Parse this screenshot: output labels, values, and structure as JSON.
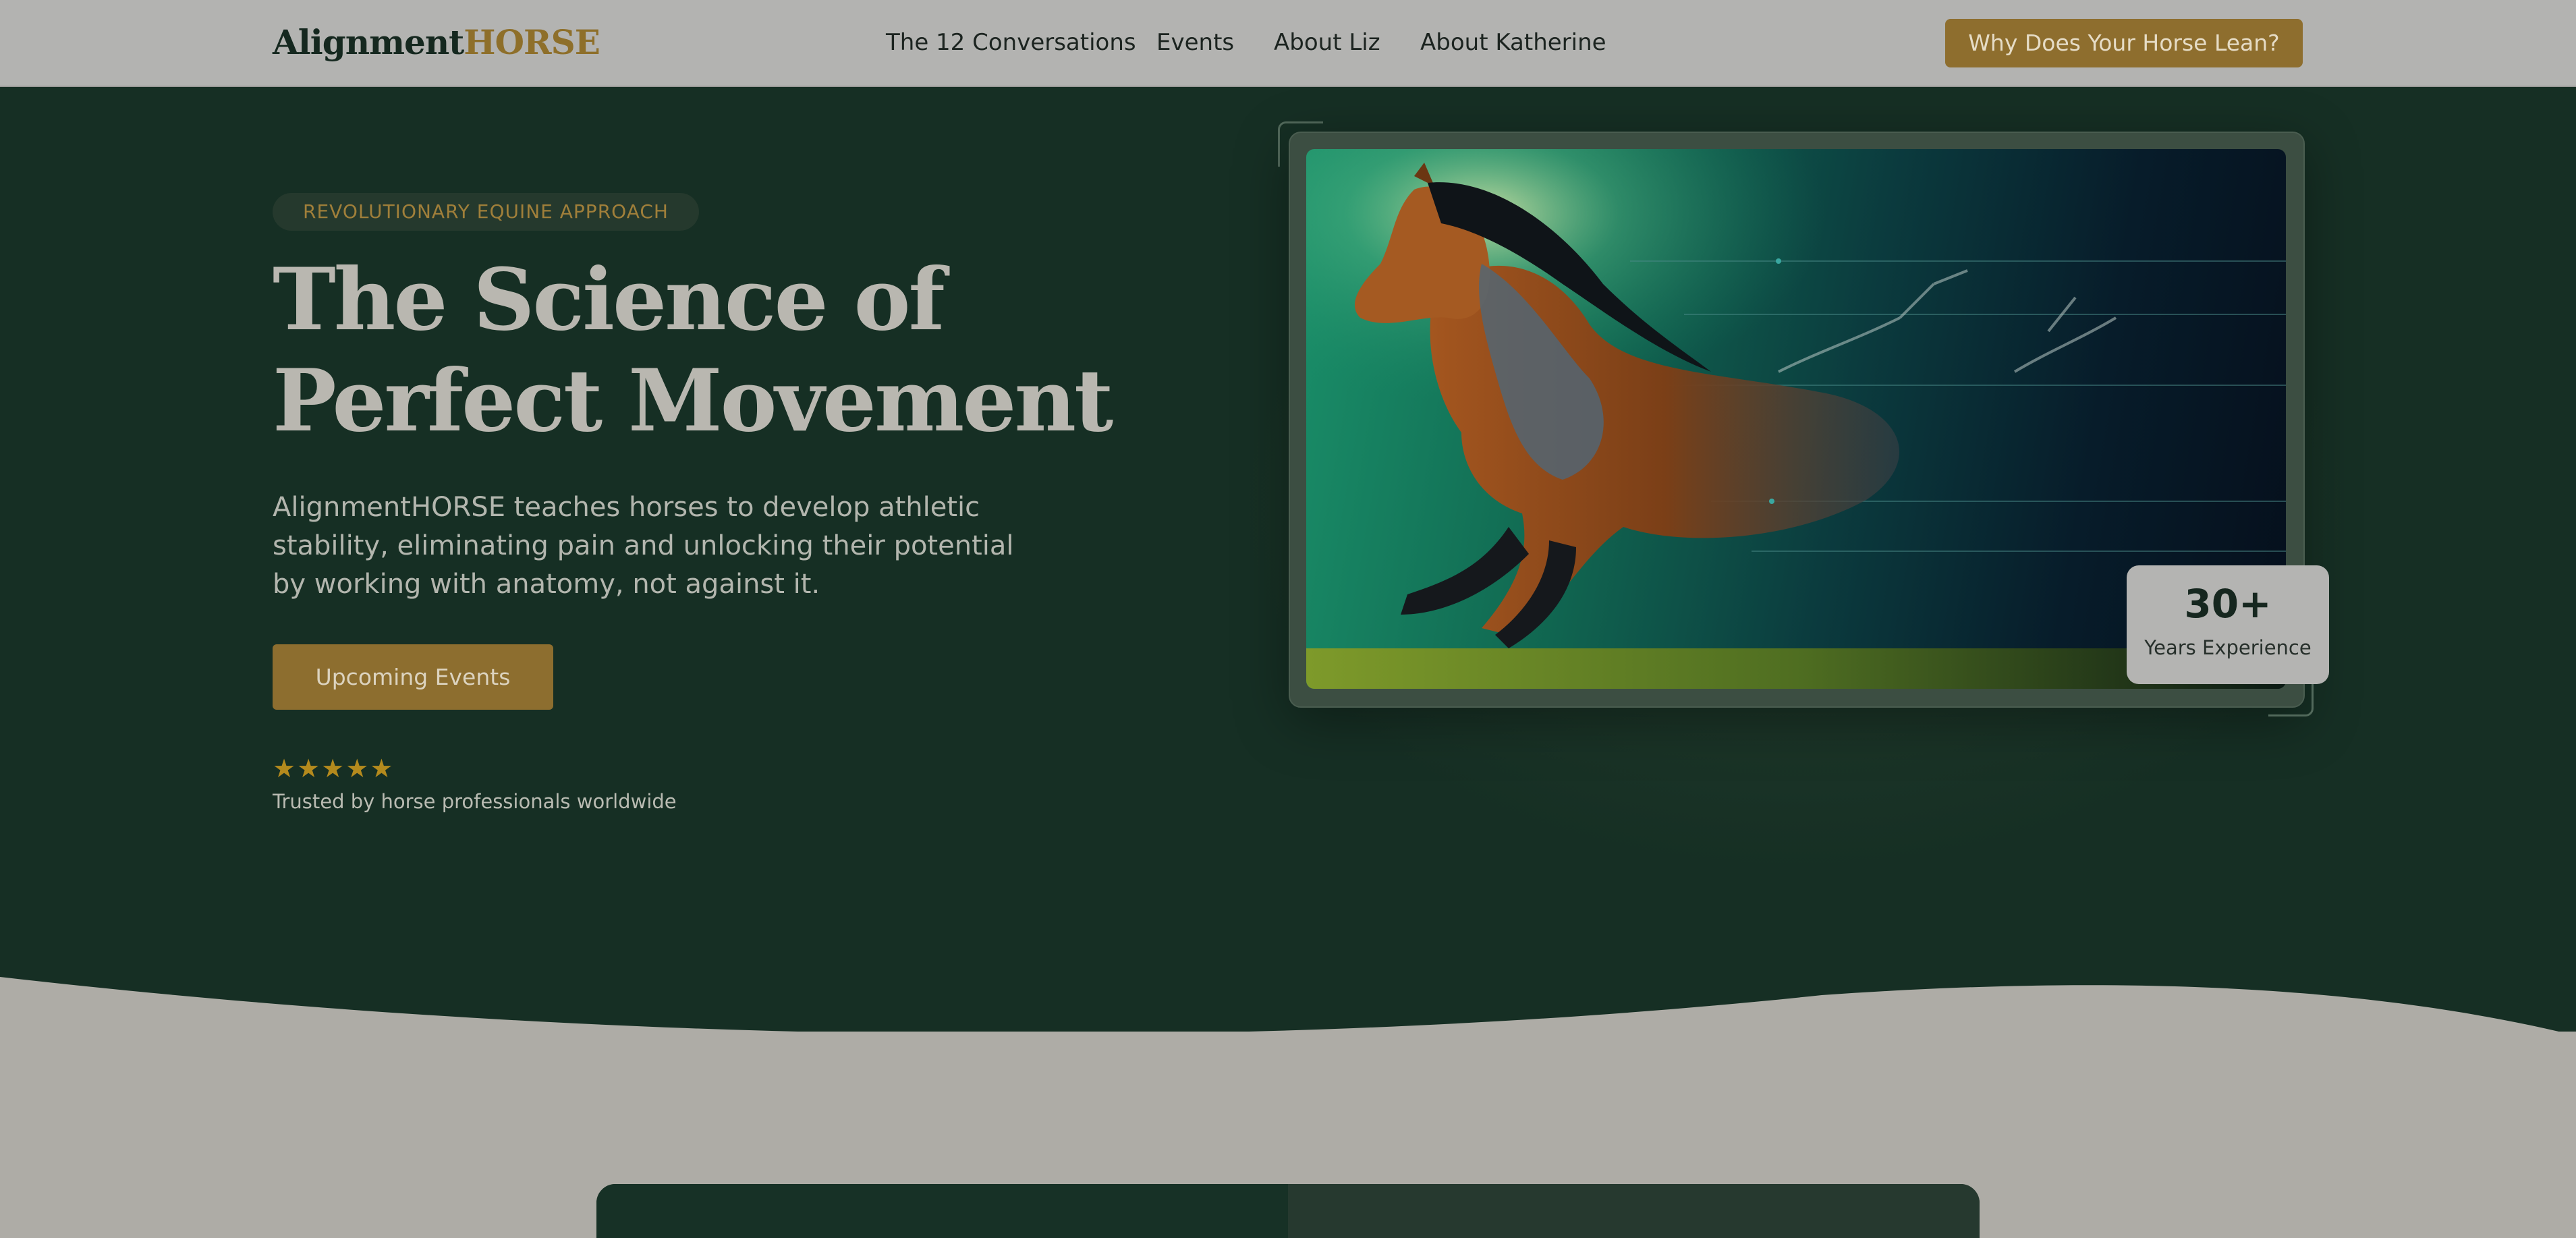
{
  "brand": {
    "logo_part1": "Alignment",
    "logo_part2": "HORSE",
    "color_dark": "#15281f",
    "color_gold": "#8e6f2a"
  },
  "nav": {
    "links": [
      "The 12 Conversations",
      "Events",
      "About Liz",
      "About Katherine"
    ],
    "cta": "Why Does Your Horse Lean?"
  },
  "hero": {
    "badge": "REVOLUTIONARY EQUINE APPROACH",
    "title": "The Science of Perfect Movement",
    "description": "AlignmentHORSE teaches horses to develop athletic stability, eliminating pain and unlocking their potential by working with anatomy, not against it.",
    "button": "Upcoming Events",
    "rating": 5,
    "trusted_text": "Trusted by horse professionals worldwide",
    "stat_value": "30+",
    "stat_label": "Years Experience"
  },
  "colors": {
    "hero_bg": "#162f24",
    "accent_gold": "#8e6e2e",
    "page_bg": "#aeaca6"
  }
}
